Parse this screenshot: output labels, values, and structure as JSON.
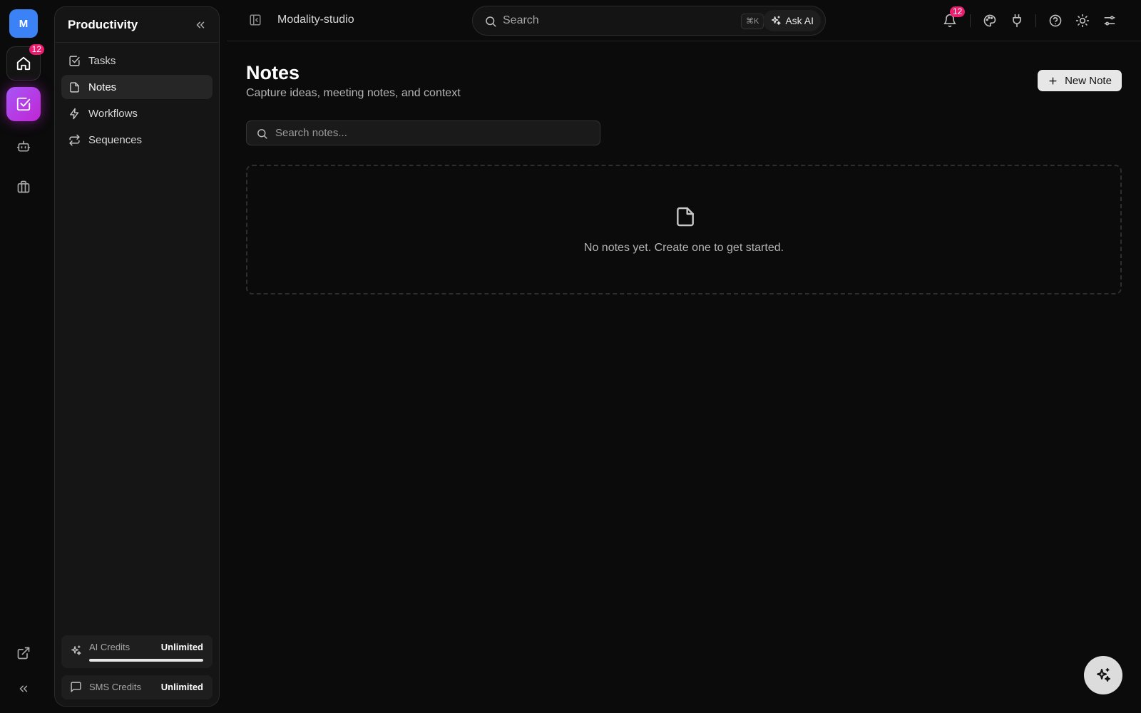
{
  "rail": {
    "avatar_initial": "M",
    "home_badge": "12"
  },
  "sidebar": {
    "title": "Productivity",
    "items": [
      {
        "label": "Tasks",
        "icon": "square-check-icon"
      },
      {
        "label": "Notes",
        "icon": "file-icon",
        "active": true
      },
      {
        "label": "Workflows",
        "icon": "zap-icon"
      },
      {
        "label": "Sequences",
        "icon": "repeat-icon"
      }
    ],
    "credits": {
      "ai_label": "AI Credits",
      "ai_value": "Unlimited",
      "ai_usage_fraction": 1.0,
      "sms_label": "SMS Credits",
      "sms_value": "Unlimited"
    }
  },
  "topbar": {
    "workspace": "Modality-studio",
    "search_placeholder": "Search",
    "shortcut": "⌘K",
    "ask_ai_label": "Ask AI",
    "notification_count": "12"
  },
  "main": {
    "title": "Notes",
    "subtitle": "Capture ideas, meeting notes, and context",
    "new_note_label": "New Note",
    "search_placeholder": "Search notes...",
    "empty_message": "No notes yet. Create one to get started."
  },
  "colors": {
    "accent": "#a855f7",
    "badge": "#ec1c6e",
    "avatar": "#3b82f6"
  }
}
